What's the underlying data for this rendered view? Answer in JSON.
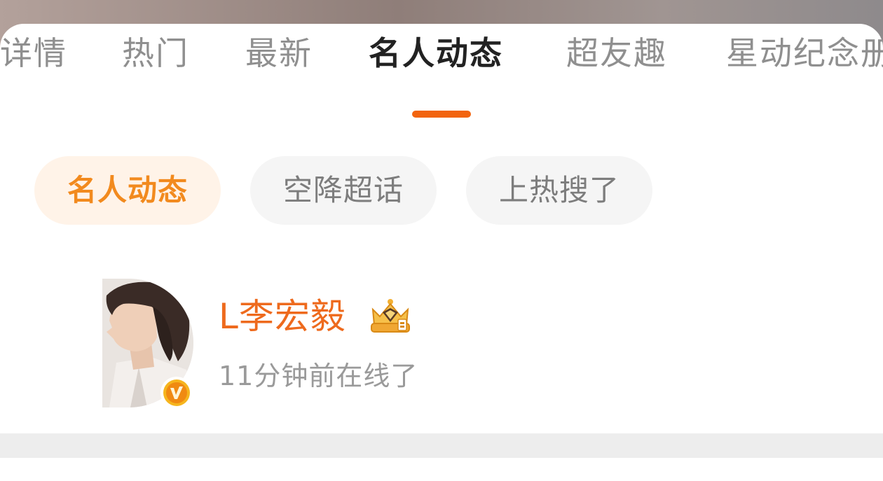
{
  "tabs": [
    {
      "label": "详情",
      "active": false
    },
    {
      "label": "热门",
      "active": false
    },
    {
      "label": "最新",
      "active": false
    },
    {
      "label": "名人动态",
      "active": true
    },
    {
      "label": "超友趣",
      "active": false
    },
    {
      "label": "星动纪念册",
      "active": false
    }
  ],
  "chips": [
    {
      "label": "名人动态",
      "active": true
    },
    {
      "label": "空降超话",
      "active": false
    },
    {
      "label": "上热搜了",
      "active": false
    }
  ],
  "user": {
    "name": "L李宏毅",
    "status": "11分钟前在线了",
    "verified_icon": "verified-v-icon",
    "badge_icon": "crown-icon"
  },
  "colors": {
    "accent": "#f2640f",
    "chip_active_text": "#f28a1e",
    "chip_active_bg": "#fff3e8",
    "username": "#ee6a1d"
  }
}
